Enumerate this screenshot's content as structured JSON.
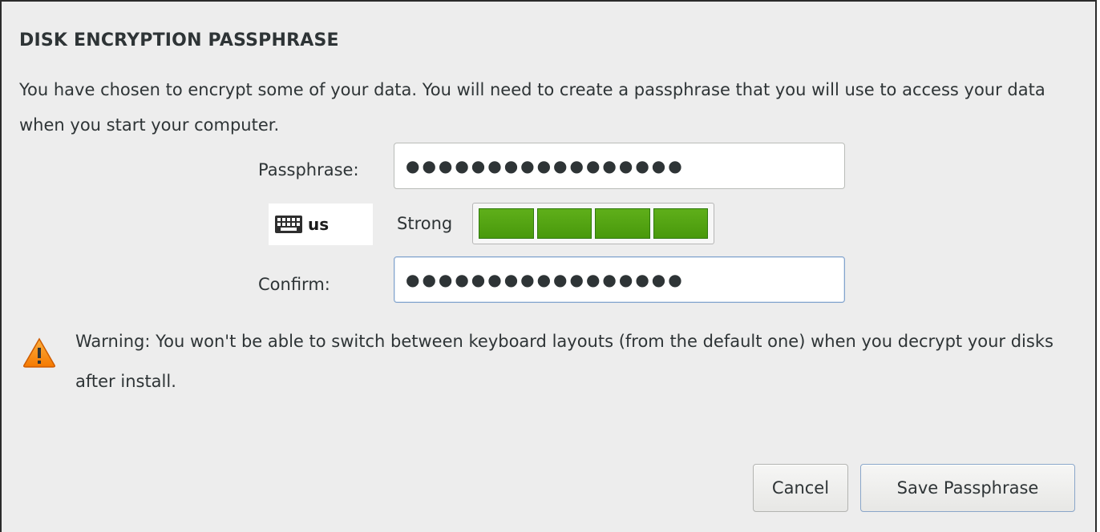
{
  "dialog": {
    "title": "DISK ENCRYPTION PASSPHRASE",
    "description": "You have chosen to encrypt some of your data. You will need to create a passphrase that you will use to access your data when you start your computer."
  },
  "form": {
    "passphrase_label": "Passphrase:",
    "passphrase_value": "●●●●●●●●●●●●●●●●●",
    "confirm_label": "Confirm:",
    "confirm_value": "●●●●●●●●●●●●●●●●●",
    "keyboard_layout": "us",
    "keyboard_icon": "keyboard-icon",
    "strength_label": "Strong",
    "strength_level": 1.0,
    "strength_segments_filled": 4,
    "strength_segments_total": 4,
    "strength_color": "#53a413"
  },
  "warning": {
    "icon": "warning-triangle-icon",
    "text": "Warning: You won't be able to switch between keyboard layouts (from the default one) when you decrypt your disks after install.",
    "color": "#f57900"
  },
  "buttons": {
    "cancel": "Cancel",
    "save": "Save Passphrase"
  }
}
